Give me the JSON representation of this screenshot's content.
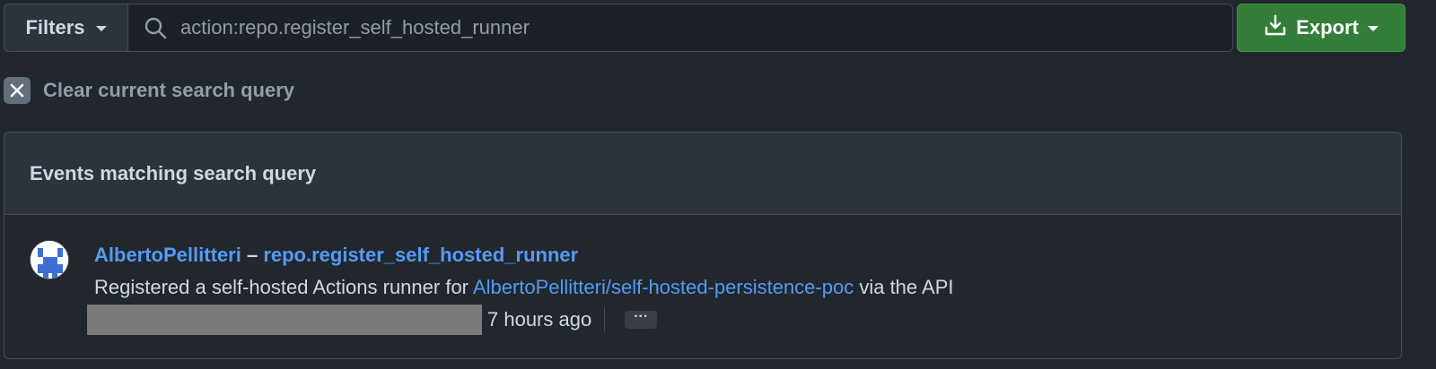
{
  "toolbar": {
    "filters_label": "Filters",
    "search_value": "action:repo.register_self_hosted_runner",
    "export_label": "Export"
  },
  "clear": {
    "label": "Clear current search query"
  },
  "panel": {
    "title": "Events matching search query",
    "events": [
      {
        "actor": "AlbertoPellitteri",
        "separator": "–",
        "action": "repo.register_self_hosted_runner",
        "description_prefix": "Registered a self-hosted Actions runner for ",
        "repo": "AlbertoPellitteri/self-hosted-persistence-poc",
        "description_suffix": " via the API",
        "time": "7 hours ago",
        "more_label": "···"
      }
    ]
  },
  "colors": {
    "background": "#22272e",
    "export_green": "#347d39",
    "link_blue": "#539bf5"
  },
  "icons": {
    "search": "search-icon",
    "export": "download-icon",
    "clear": "x-icon",
    "caret": "triangle-down-icon"
  }
}
